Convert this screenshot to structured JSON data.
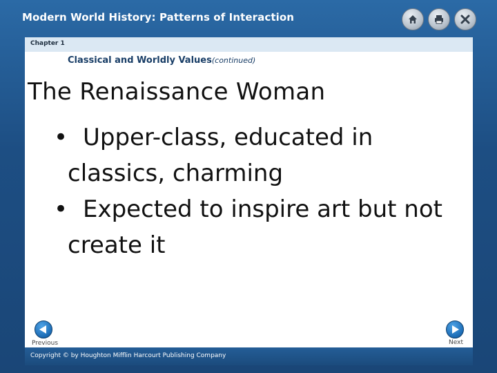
{
  "header": {
    "title": "Modern World History: Patterns of Interaction",
    "icons": [
      "home-icon",
      "print-icon",
      "close-icon"
    ]
  },
  "chapter": {
    "label": "Chapter 1"
  },
  "slide": {
    "section": "Classical and Worldly Values",
    "section_suffix": "(continued)",
    "heading": "The Renaissance Woman",
    "bullets": [
      "Upper-class, educated in classics, charming",
      "Expected to inspire art but not create it"
    ]
  },
  "nav": {
    "previous_label": "Previous",
    "next_label": "Next"
  },
  "footer": {
    "copyright": "Copyright © by Houghton Mifflin Harcourt Publishing Company"
  },
  "colors": {
    "frame": "#1e4f82",
    "chapter_bar": "#dbe8f3",
    "nav_button": "#1c6cb5"
  }
}
